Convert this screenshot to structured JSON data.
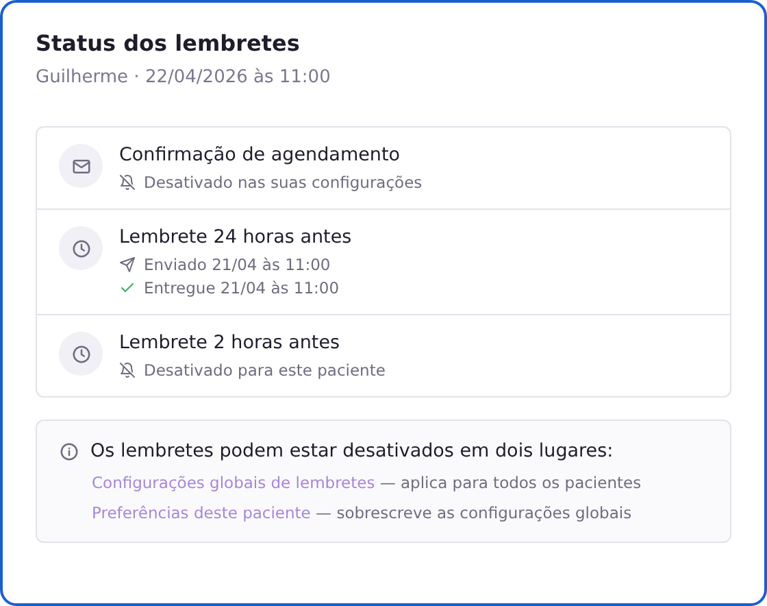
{
  "title": "Status dos lembretes",
  "subtitle": "Guilherme · 22/04/2026 às 11:00",
  "reminders": [
    {
      "kind": "mail",
      "title": "Confirmação de agendamento",
      "lines": [
        {
          "kind": "off",
          "text": "Desativado nas suas configurações"
        }
      ]
    },
    {
      "kind": "clock",
      "title": "Lembrete 24 horas antes",
      "lines": [
        {
          "kind": "sent",
          "text": "Enviado 21/04 às 11:00"
        },
        {
          "kind": "delivered",
          "text": "Entregue 21/04 às 11:00"
        }
      ]
    },
    {
      "kind": "clock",
      "title": "Lembrete 2 horas antes",
      "lines": [
        {
          "kind": "off",
          "text": "Desativado para este paciente"
        }
      ]
    }
  ],
  "info": {
    "heading": "Os lembretes podem estar desativados em dois lugares:",
    "lines": [
      {
        "link": "Configurações globais de lembretes",
        "text": " — aplica para todos os pacientes"
      },
      {
        "link": "Preferências deste paciente",
        "text": " — sobrescreve as configurações globais"
      }
    ]
  }
}
